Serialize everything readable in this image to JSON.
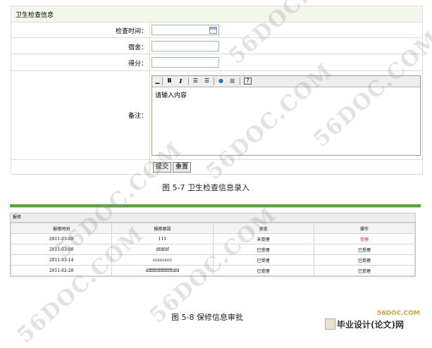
{
  "form": {
    "header": "卫生检查信息",
    "rows": {
      "check_time_label": "检查时间：",
      "dorm_label": "宿舍：",
      "score_label": "得分：",
      "remark_label": "备注："
    },
    "editor": {
      "placeholder": "请输入内容",
      "toolbar": {
        "bold": "B",
        "italic": "I",
        "help": "?"
      }
    },
    "buttons": {
      "submit": "提交",
      "reset": "重置"
    }
  },
  "caption1": "图 5-7  卫生检查信息录入",
  "repair": {
    "title": "报修",
    "columns": [
      "报修时间",
      "报修原因",
      "状态",
      "操作"
    ],
    "rows": [
      {
        "time": "2011-03-08",
        "reason": "111",
        "status": "未受理",
        "action": "受理"
      },
      {
        "time": "2011-03-08",
        "reason": "dfdfdf",
        "status": "已受理",
        "action": "已受理"
      },
      {
        "time": "2011-03-14",
        "reason": "cccccccc",
        "status": "已受理",
        "action": "已受理"
      },
      {
        "time": "2011-02-28",
        "reason": "dffffffffffffffffdfd",
        "status": "已受理",
        "action": "已受理"
      }
    ]
  },
  "caption2": "图 5-8 保修信息审批",
  "watermark": "56DOC.COM",
  "brand": {
    "small": "56DOC.COM",
    "main": "毕业设计(论文)网"
  }
}
